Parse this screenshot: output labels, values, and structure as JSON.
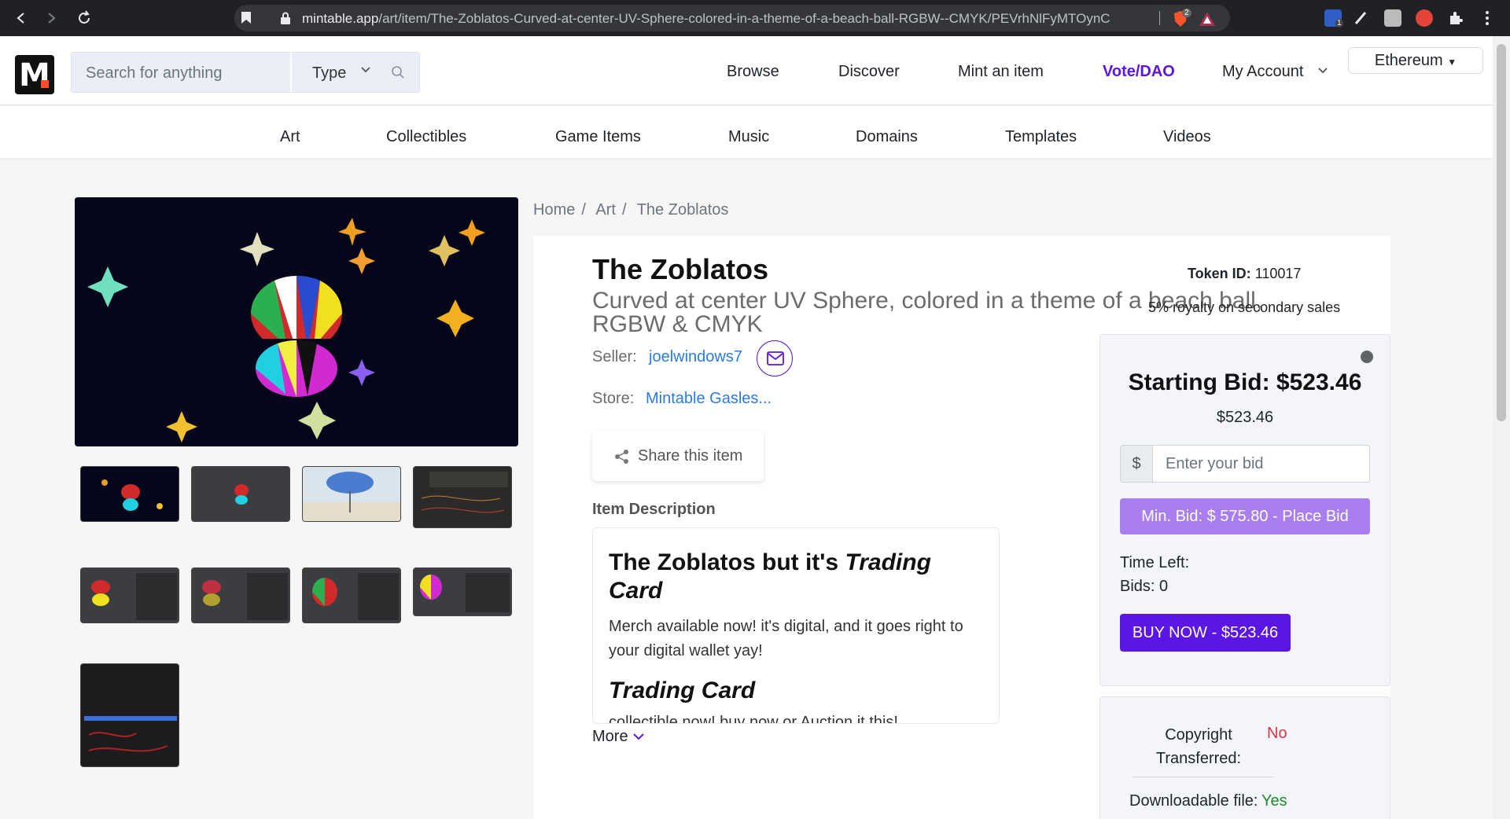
{
  "browser": {
    "url_host": "mintable.app",
    "url_path": "/art/item/The-Zoblatos-Curved-at-center-UV-Sphere-colored-in-a-theme-of-a-beach-ball-RGBW--CMYK/PEVrhNlFyMTOynC",
    "brave_badge": "2",
    "ext_badge": "1"
  },
  "header": {
    "search_placeholder": "Search for anything",
    "type_label": "Type",
    "nav": {
      "browse": "Browse",
      "discover": "Discover",
      "mint": "Mint an item",
      "vote": "Vote/DAO",
      "account": "My Account"
    },
    "network": "Ethereum",
    "colors": {
      "accent": "#5b16e6"
    }
  },
  "categories": [
    "Art",
    "Collectibles",
    "Game Items",
    "Music",
    "Domains",
    "Templates",
    "Videos"
  ],
  "breadcrumb": [
    "Home",
    "Art",
    "The Zoblatos"
  ],
  "item": {
    "title": "The Zoblatos",
    "subtitle": "Curved at center UV Sphere, colored in a theme of a beach ball, RGBW & CMYK",
    "token_label": "Token ID:",
    "token_id": "110017",
    "royalty": "5% royalty on secondary sales",
    "seller_label": "Seller:",
    "seller": "joelwindows7",
    "store_label": "Store:",
    "store": "Mintable Gasles...",
    "share_label": "Share this item",
    "description_heading": "Item Description",
    "description": {
      "heading_plain": "The Zoblatos but it's ",
      "heading_italic": "Trading Card",
      "body": "Merch available now! it's digital, and it goes right to your digital wallet yay!",
      "heading2": "Trading Card",
      "body2": "collectible now! buy now or Auction it this!"
    },
    "more_label": "More"
  },
  "bid": {
    "starting_bid": "Starting Bid: $523.46",
    "starting_sub": "$523.46",
    "currency_symbol": "$",
    "input_placeholder": "Enter your bid",
    "place_bid": "Min. Bid: $ 575.80 - Place Bid",
    "time_left": "Time Left:",
    "bids": "Bids: 0",
    "buy_now": "BUY NOW - $523.46"
  },
  "info": {
    "copyright_label": "Copyright Transferred:",
    "copyright_value": "No",
    "downloadable_label": "Downloadable file:",
    "downloadable_value": "Yes"
  }
}
